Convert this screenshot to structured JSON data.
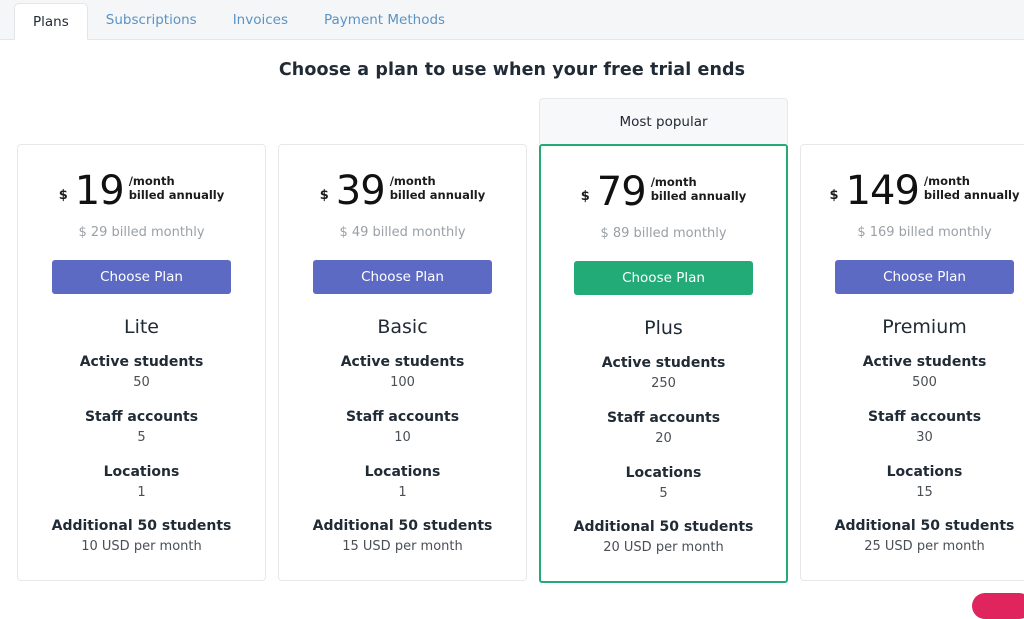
{
  "tabs": [
    {
      "label": "Plans",
      "active": true
    },
    {
      "label": "Subscriptions",
      "active": false
    },
    {
      "label": "Invoices",
      "active": false
    },
    {
      "label": "Payment Methods",
      "active": false
    }
  ],
  "heading": "Choose a plan to use when your free trial ends",
  "popular_badge": "Most popular",
  "labels": {
    "currency": "$",
    "per_month": "/month",
    "billed_annually": "billed annually",
    "choose_plan": "Choose Plan"
  },
  "colors": {
    "primary_button": "#5c6ac4",
    "highlight_button": "#23ab77",
    "highlight_border": "#23ab77",
    "tab_link": "#5c93c4",
    "tabbar_bg": "#f4f6f8",
    "chat_widget": "#e0245e"
  },
  "plans": [
    {
      "name": "Lite",
      "price": "19",
      "monthly_note": "$ 29 billed monthly",
      "popular": false,
      "features": [
        {
          "label": "Active students",
          "value": "50"
        },
        {
          "label": "Staff accounts",
          "value": "5"
        },
        {
          "label": "Locations",
          "value": "1"
        },
        {
          "label": "Additional 50 students",
          "value": "10 USD per month"
        }
      ]
    },
    {
      "name": "Basic",
      "price": "39",
      "monthly_note": "$ 49 billed monthly",
      "popular": false,
      "features": [
        {
          "label": "Active students",
          "value": "100"
        },
        {
          "label": "Staff accounts",
          "value": "10"
        },
        {
          "label": "Locations",
          "value": "1"
        },
        {
          "label": "Additional 50 students",
          "value": "15 USD per month"
        }
      ]
    },
    {
      "name": "Plus",
      "price": "79",
      "monthly_note": "$ 89 billed monthly",
      "popular": true,
      "features": [
        {
          "label": "Active students",
          "value": "250"
        },
        {
          "label": "Staff accounts",
          "value": "20"
        },
        {
          "label": "Locations",
          "value": "5"
        },
        {
          "label": "Additional 50 students",
          "value": "20 USD per month"
        }
      ]
    },
    {
      "name": "Premium",
      "price": "149",
      "monthly_note": "$ 169 billed monthly",
      "popular": false,
      "features": [
        {
          "label": "Active students",
          "value": "500"
        },
        {
          "label": "Staff accounts",
          "value": "30"
        },
        {
          "label": "Locations",
          "value": "15"
        },
        {
          "label": "Additional 50 students",
          "value": "25 USD per month"
        }
      ]
    }
  ]
}
